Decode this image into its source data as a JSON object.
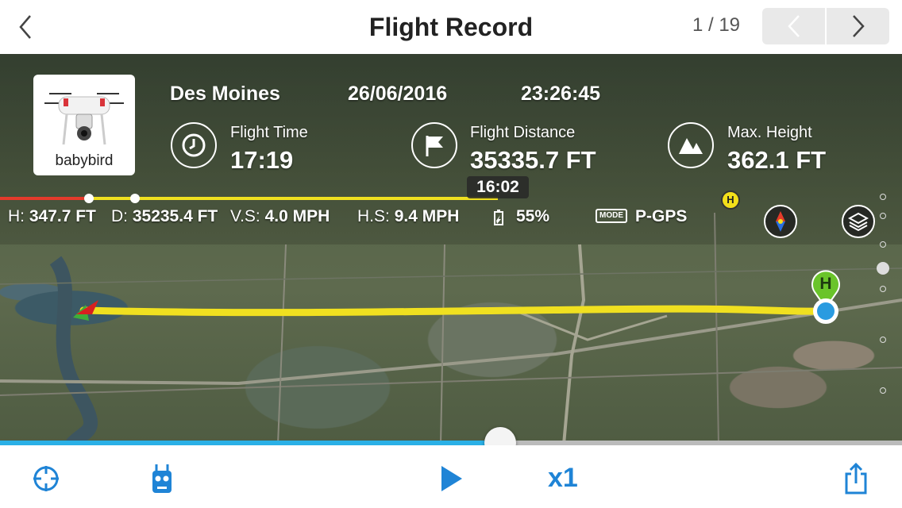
{
  "header": {
    "title": "Flight Record",
    "page_indicator": "1 / 19"
  },
  "flight": {
    "drone_name": "babybird",
    "location": "Des Moines",
    "date": "26/06/2016",
    "time": "23:26:45"
  },
  "stats": {
    "flight_time_label": "Flight Time",
    "flight_time_value": "17:19",
    "flight_distance_label": "Flight Distance",
    "flight_distance_value": "35335.7 FT",
    "max_height_label": "Max. Height",
    "max_height_value": "362.1 FT"
  },
  "timeline": {
    "timestamp": "16:02"
  },
  "telemetry": {
    "h_label": "H:",
    "h_value": "347.7 FT",
    "d_label": "D:",
    "d_value": "35235.4 FT",
    "vs_label": "V.S:",
    "vs_value": "4.0 MPH",
    "hs_label": "H.S:",
    "hs_value": "9.4 MPH",
    "battery_value": "55%",
    "mode_badge": "MODE",
    "mode_value": "P-GPS"
  },
  "markers": {
    "home_label": "H",
    "home_small_label": "H"
  },
  "playback": {
    "speed": "x1",
    "progress": 0.555
  },
  "colors": {
    "accent": "#1f84d6",
    "track": "#f0e020",
    "progress_red": "#e53b2b",
    "slider_fill": "#2ab0e6",
    "home_marker": "#6ac42a"
  },
  "icons": {
    "back": "chevron-left-icon",
    "prev": "chevron-left-icon",
    "next": "chevron-right-icon",
    "clock": "clock-icon",
    "flag": "flag-icon",
    "mountain": "mountain-icon",
    "battery": "battery-icon",
    "compass": "compass-icon",
    "layers": "layers-icon",
    "locate": "crosshair-icon",
    "remote": "remote-controller-icon",
    "play": "play-icon",
    "share": "share-icon"
  }
}
